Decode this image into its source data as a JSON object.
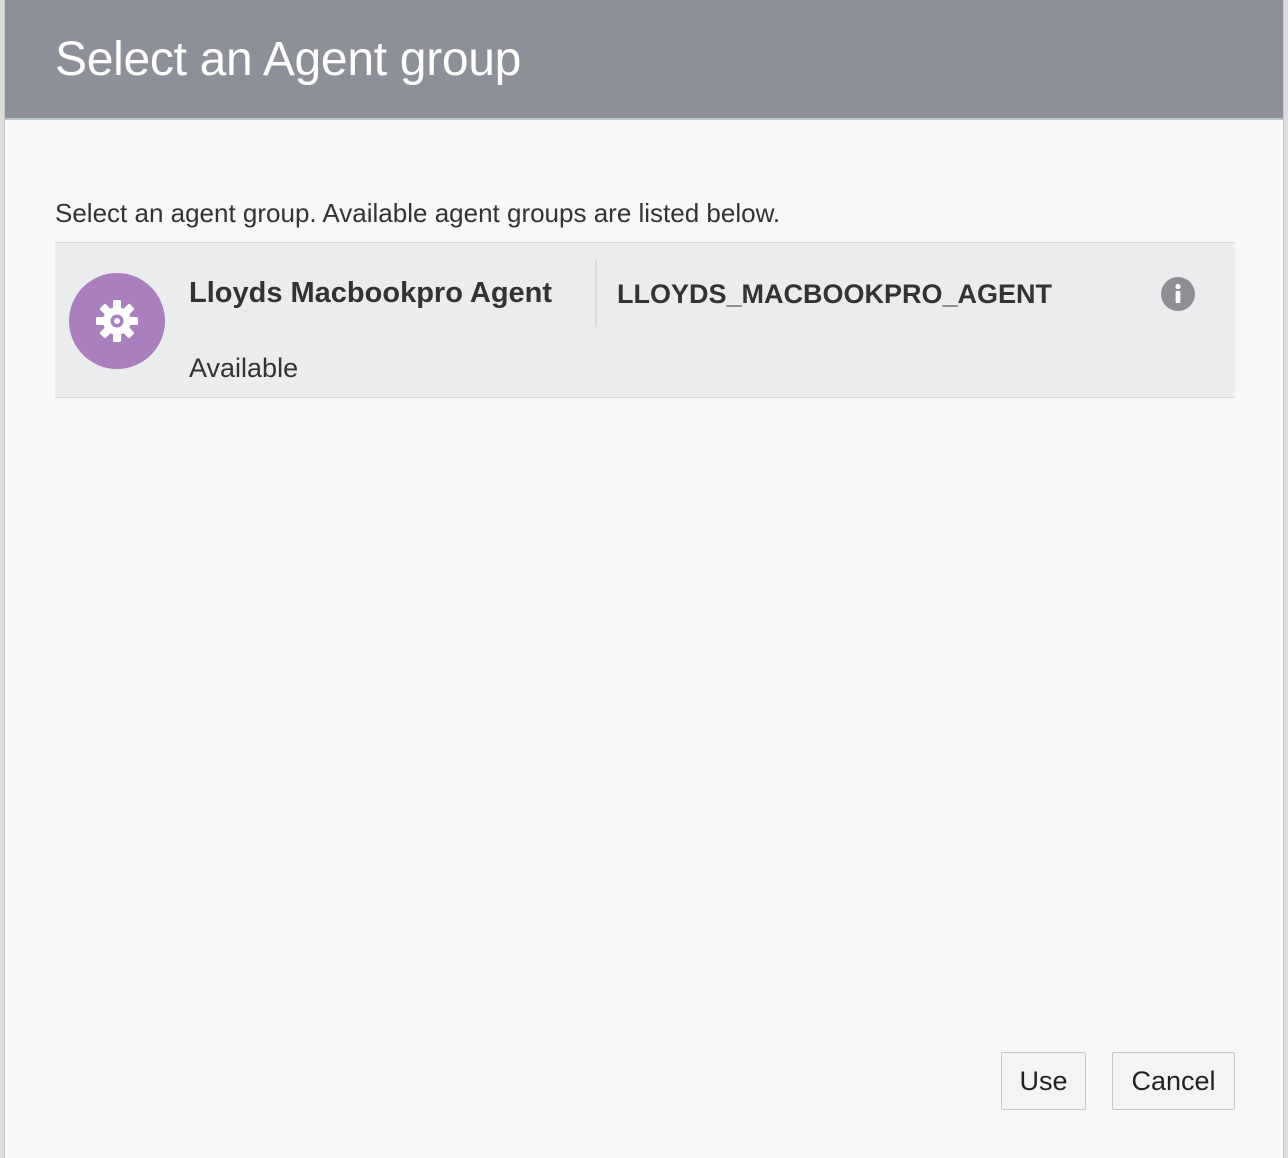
{
  "dialog": {
    "title": "Select an Agent group",
    "instructions": "Select an agent group. Available agent groups are listed below."
  },
  "agent_groups": [
    {
      "name": "Lloyds Macbookpro Agent",
      "code": "LLOYDS_MACBOOKPRO_AGENT",
      "status": "Available",
      "icon": "gear-icon",
      "avatar_color": "#a97fbd"
    }
  ],
  "buttons": {
    "use_label": "Use",
    "cancel_label": "Cancel"
  },
  "colors": {
    "header_bg": "#8e9099",
    "body_bg": "#f8f8f8",
    "list_item_bg": "#ebecee"
  }
}
